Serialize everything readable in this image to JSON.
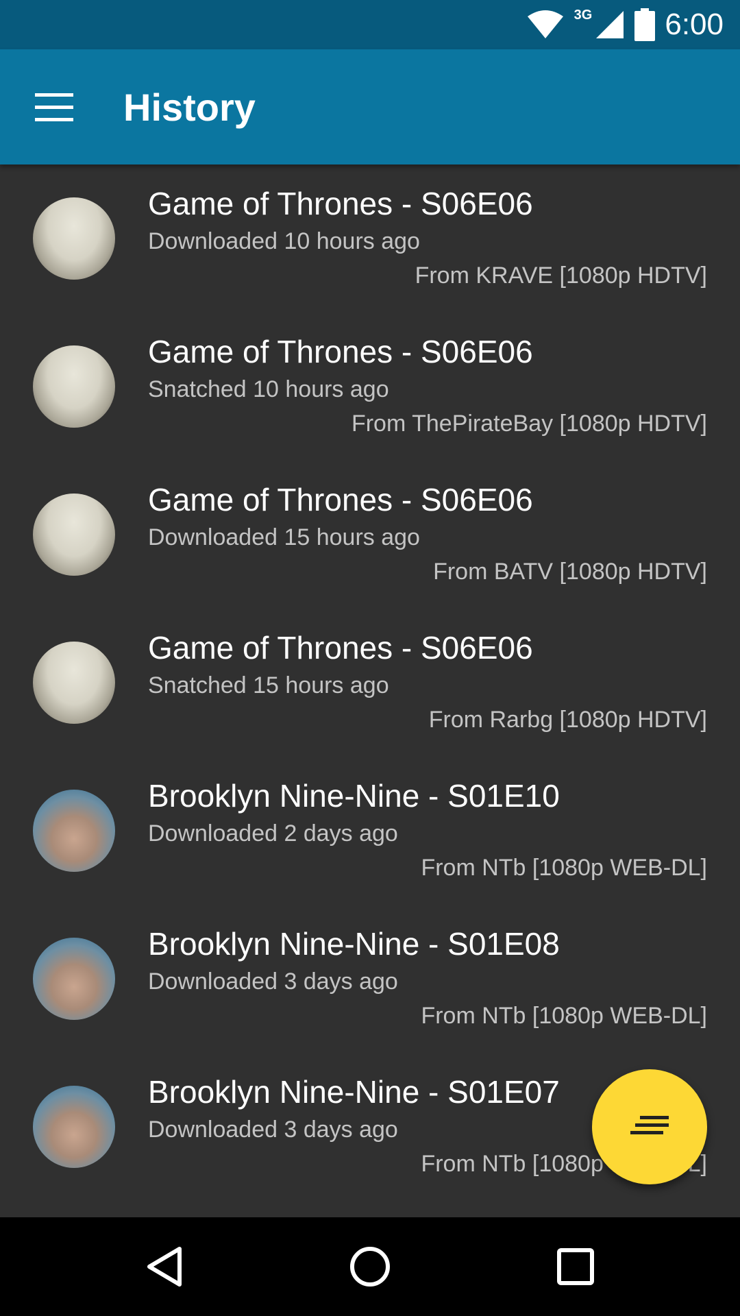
{
  "status_bar": {
    "network": "3G",
    "time": "6:00",
    "icons": [
      "wifi-icon",
      "cell-signal-icon",
      "battery-icon"
    ]
  },
  "app_bar": {
    "title": "History",
    "menu_icon": "hamburger-menu-icon",
    "color": "#0b76a0"
  },
  "history": [
    {
      "title": "Game of Thrones - S06E06",
      "status": "Downloaded 10 hours ago",
      "source": "From KRAVE [1080p HDTV]",
      "show": "got"
    },
    {
      "title": "Game of Thrones - S06E06",
      "status": "Snatched 10 hours ago",
      "source": "From ThePirateBay [1080p HDTV]",
      "show": "got"
    },
    {
      "title": "Game of Thrones - S06E06",
      "status": "Downloaded 15 hours ago",
      "source": "From BATV [1080p HDTV]",
      "show": "got"
    },
    {
      "title": "Game of Thrones - S06E06",
      "status": "Snatched 15 hours ago",
      "source": "From Rarbg [1080p HDTV]",
      "show": "got"
    },
    {
      "title": "Brooklyn Nine-Nine - S01E10",
      "status": "Downloaded 2 days ago",
      "source": "From NTb [1080p WEB-DL]",
      "show": "b99"
    },
    {
      "title": "Brooklyn Nine-Nine - S01E08",
      "status": "Downloaded 3 days ago",
      "source": "From NTb [1080p WEB-DL]",
      "show": "b99"
    },
    {
      "title": "Brooklyn Nine-Nine - S01E07",
      "status": "Downloaded 3 days ago",
      "source": "From NTb [1080p WEB-DL]",
      "show": "b99"
    }
  ],
  "fab": {
    "icon": "filter-sort-icon",
    "color": "#fdd835"
  },
  "nav_bar": {
    "buttons": [
      "back-icon",
      "home-icon",
      "recents-icon"
    ]
  }
}
